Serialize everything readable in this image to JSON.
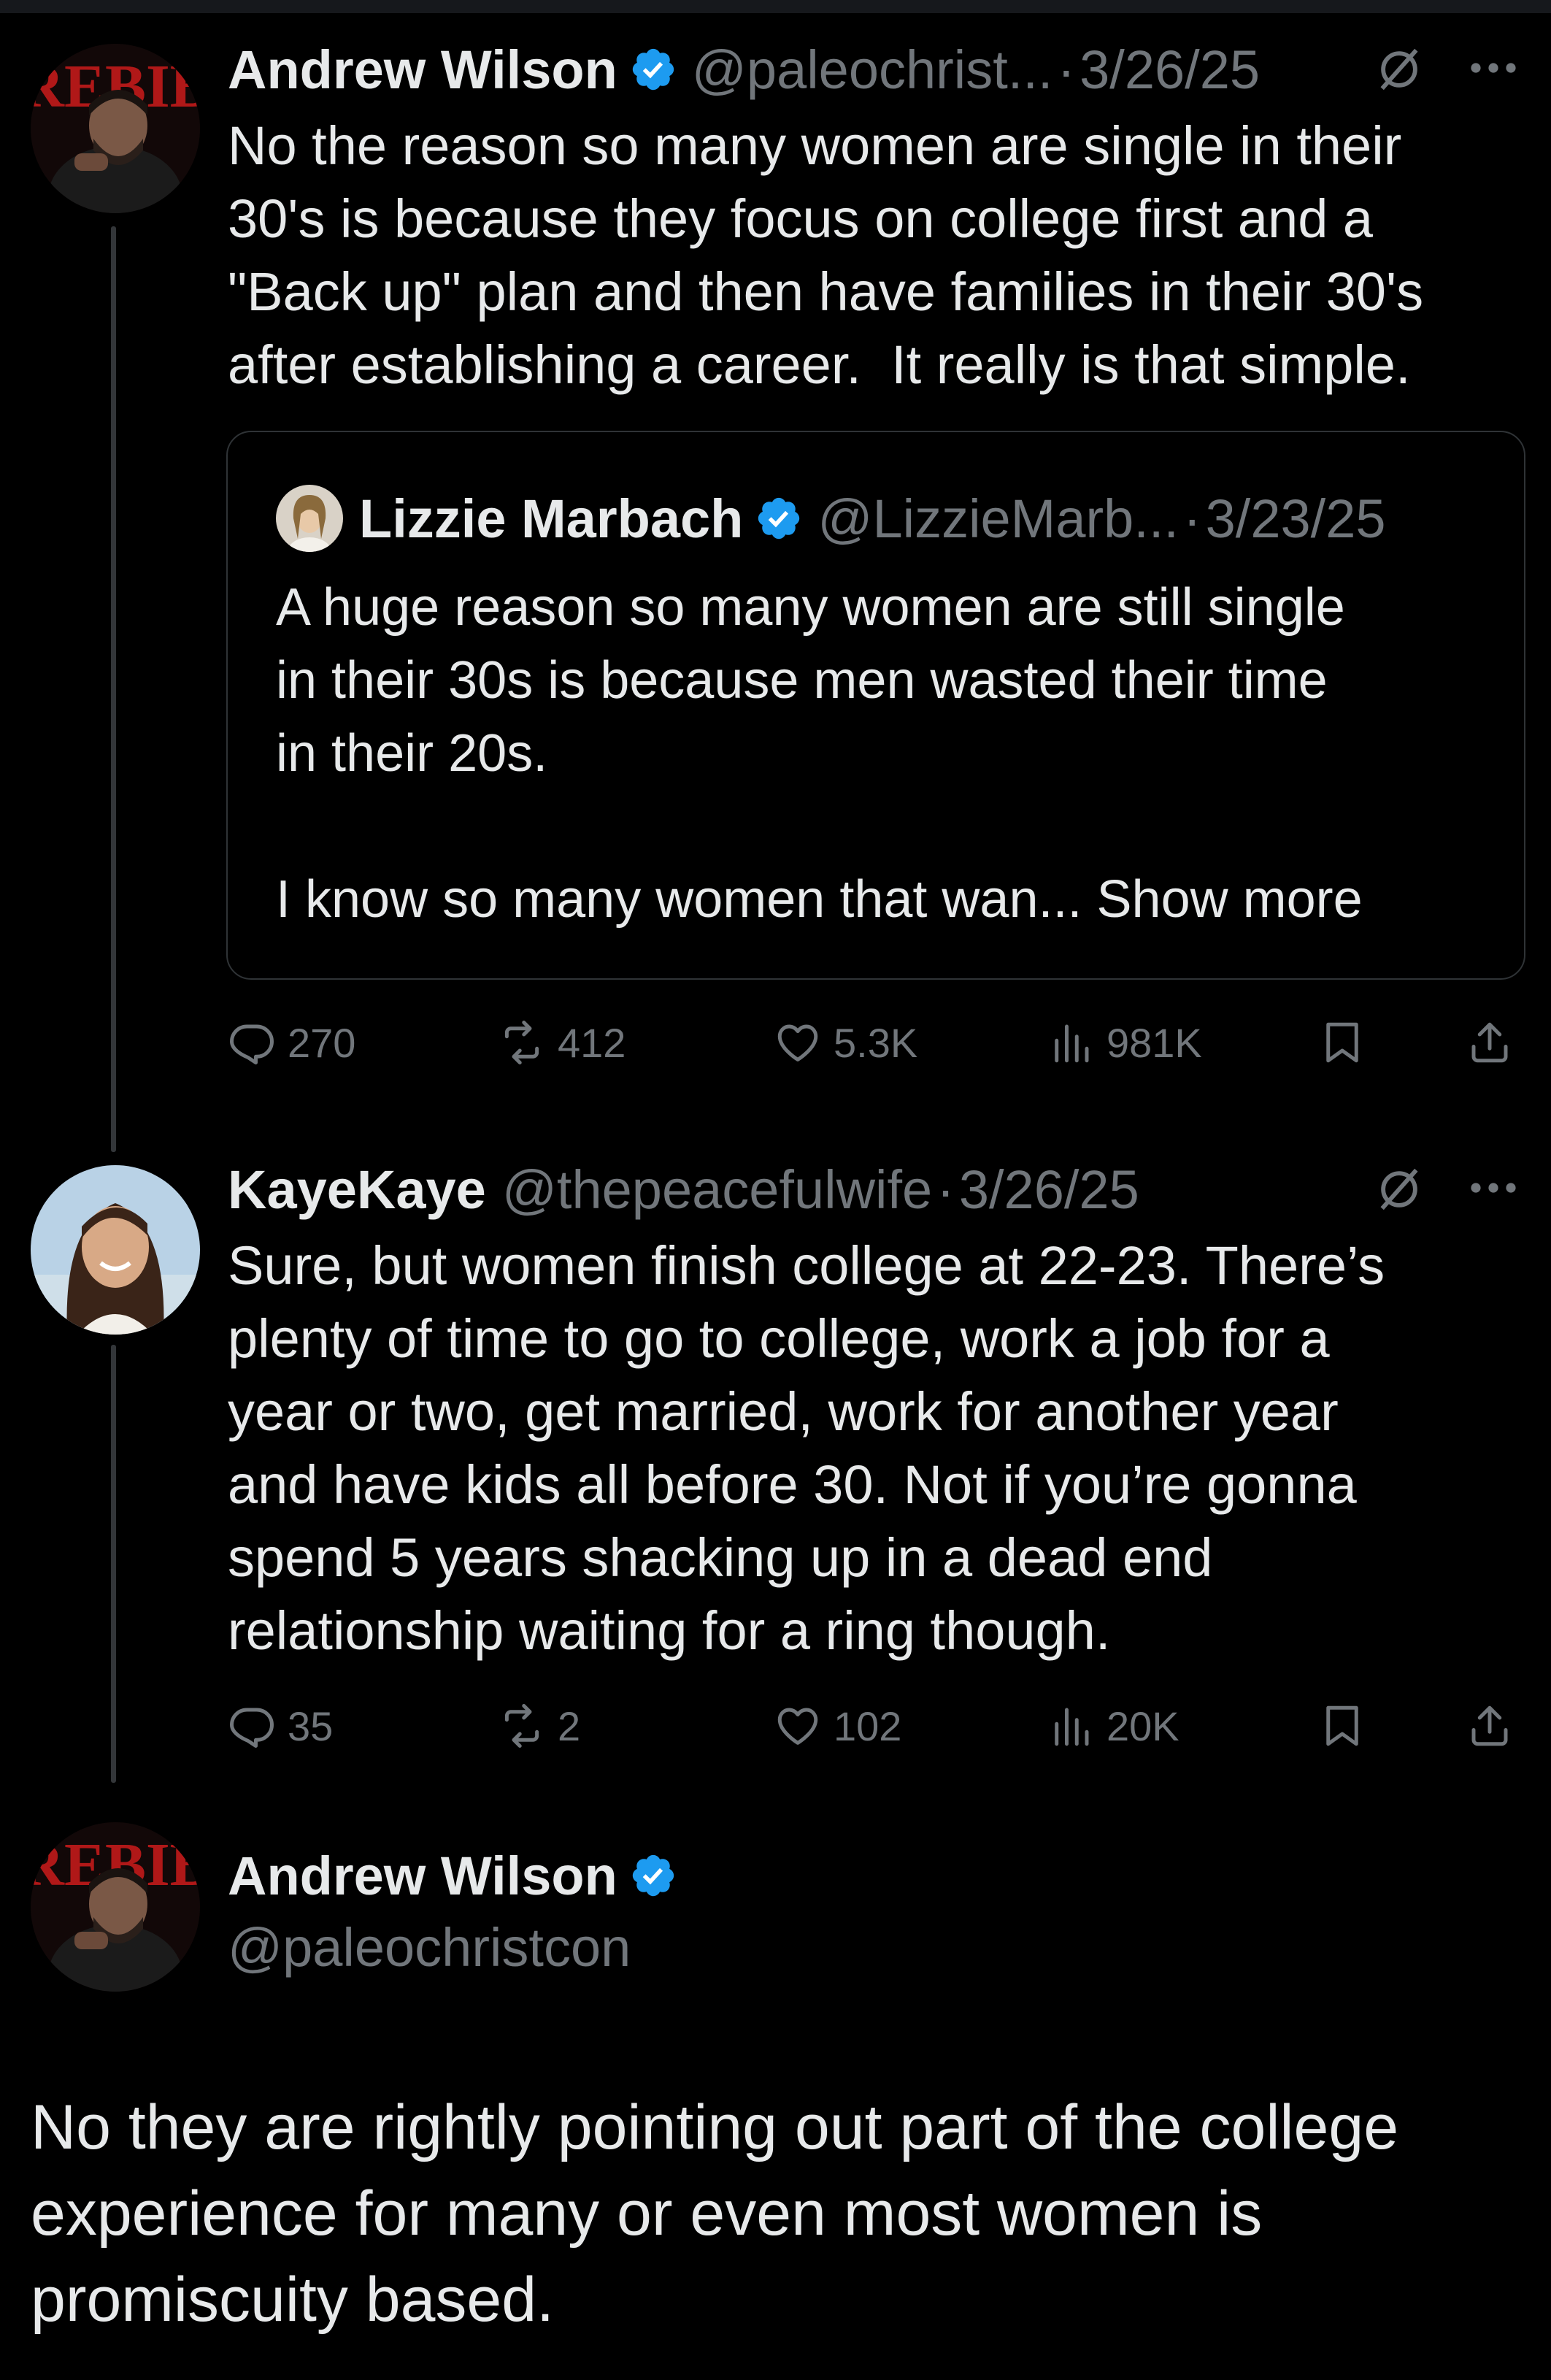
{
  "tweet1": {
    "name": "Andrew Wilson",
    "handle": "@paleochrist...",
    "sep": "·",
    "date": "3/26/25",
    "text": "No the reason so many women are single in their\n30's is because they focus on college first and a\n\"Back up\" plan and then have families in their 30's\nafter establishing a career.  It really is that simple.",
    "avatar_text": "REBIB",
    "quote": {
      "name": "Lizzie Marbach",
      "handle": "@LizzieMarb...",
      "sep": "·",
      "date": "3/23/25",
      "text": "A huge reason so many women are still single\nin their 30s is because men wasted their time\nin their 20s.\n\nI know so many women that wan...",
      "show_more": "Show more"
    },
    "stats": {
      "replies": "270",
      "reposts": "412",
      "likes": "5.3K",
      "views": "981K"
    }
  },
  "tweet2": {
    "name": "KayeKaye",
    "handle": "@thepeacefulwife",
    "sep": "·",
    "date": "3/26/25",
    "text": "Sure, but women finish college at 22-23. There’s\nplenty of time to go to college, work a job for a\nyear or two, get married, work for another year\nand have kids all before 30. Not if you’re gonna\nspend 5 years shacking up in a dead end\nrelationship waiting for a ring though.",
    "stats": {
      "replies": "35",
      "reposts": "2",
      "likes": "102",
      "views": "20K"
    }
  },
  "tweet3": {
    "name": "Andrew Wilson",
    "handle": "@paleochristcon",
    "text": "No they are rightly pointing out part of the college\nexperience for many or even most women is\npromiscuity based.",
    "avatar_text": "REBIB"
  },
  "icons": {
    "verified": "verified-badge-icon",
    "grok": "grok-slash-icon",
    "more": "more-dots-icon",
    "reply": "reply-bubble-icon",
    "repost": "repost-arrows-icon",
    "like": "heart-icon",
    "views": "views-bars-icon",
    "bookmark": "bookmark-icon",
    "share": "share-upload-icon"
  },
  "colors": {
    "background": "#000000",
    "text": "#e7e9ea",
    "muted": "#71767b",
    "verified": "#1d9bf0",
    "border": "#2f3336"
  }
}
